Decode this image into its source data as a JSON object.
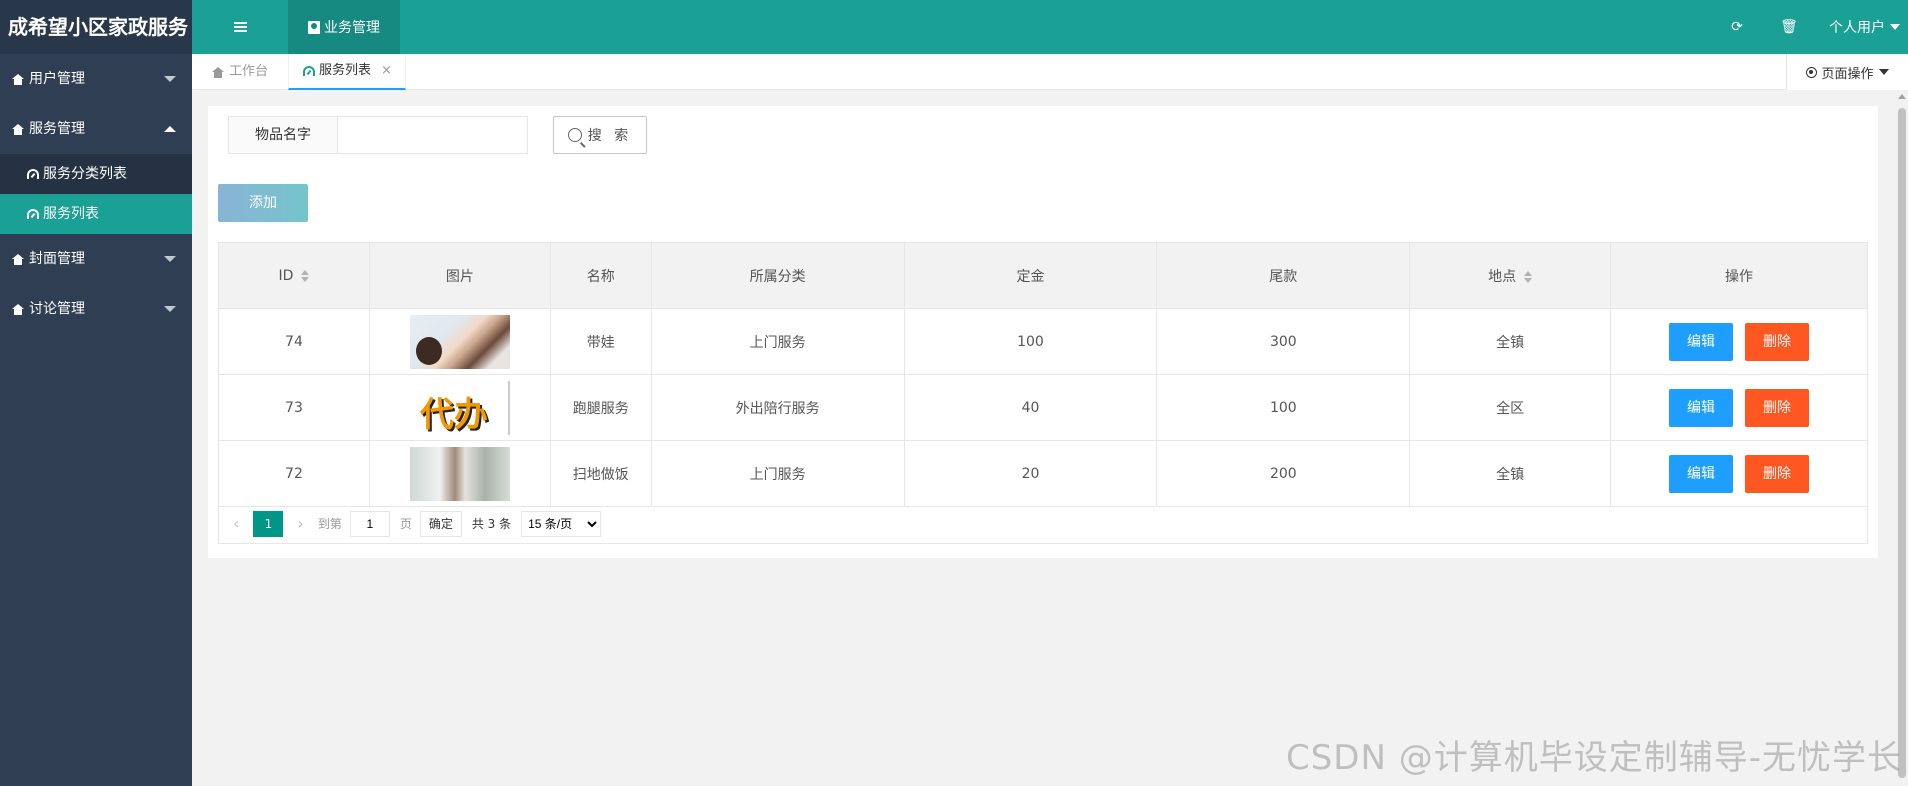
{
  "app": {
    "title": "成希望小区家政服务"
  },
  "sidebar": {
    "groups": [
      {
        "label": "用户管理"
      },
      {
        "label": "服务管理",
        "items": [
          {
            "label": "服务分类列表"
          },
          {
            "label": "服务列表"
          }
        ]
      },
      {
        "label": "封面管理"
      },
      {
        "label": "讨论管理"
      }
    ]
  },
  "header": {
    "module_tab": "业务管理",
    "user": "个人用户",
    "icons": [
      "refresh-icon",
      "trash-icon"
    ]
  },
  "tabs": {
    "home": "工作台",
    "current": "服务列表",
    "close": "×",
    "page_ops": "页面操作"
  },
  "search": {
    "label": "物品名字",
    "input_value": "",
    "button": "搜 索"
  },
  "toolbar": {
    "add": "添加"
  },
  "table": {
    "columns": [
      "ID",
      "图片",
      "名称",
      "所属分类",
      "定金",
      "尾款",
      "地点",
      "操作"
    ],
    "rows": [
      {
        "id": "74",
        "image": "baby-care-photo",
        "name": "带娃",
        "category": "上门服务",
        "deposit": "100",
        "balance": "300",
        "location": "全镇"
      },
      {
        "id": "73",
        "image": "daiban-text-graphic",
        "image_text": "代办",
        "name": "跑腿服务",
        "category": "外出陪行服务",
        "deposit": "40",
        "balance": "100",
        "location": "全区"
      },
      {
        "id": "72",
        "image": "housekeeping-photo",
        "name": "扫地做饭",
        "category": "上门服务",
        "deposit": "20",
        "balance": "200",
        "location": "全镇"
      }
    ],
    "actions": {
      "edit": "编辑",
      "delete": "删除"
    }
  },
  "pagination": {
    "current": "1",
    "goto_label": "到第",
    "goto_value": "1",
    "page_unit": "页",
    "confirm": "确定",
    "total": "共 3 条",
    "page_size": "15 条/页"
  },
  "watermark": "CSDN @计算机毕设定制辅导-无忧学长",
  "colors": {
    "teal": "#1aa094",
    "sidebar": "#2f3e52",
    "edit": "#1e9fff",
    "delete": "#ff5722",
    "pager_active": "#009688"
  }
}
